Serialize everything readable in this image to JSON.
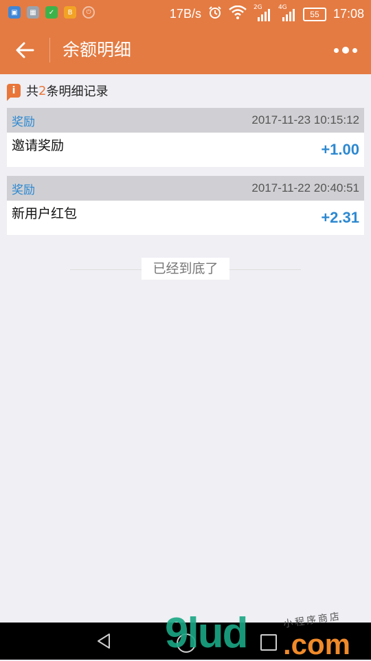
{
  "status_bar": {
    "left_icons": [
      "wallet-icon",
      "image-icon",
      "shield-icon",
      "bitcoin-icon",
      "power-icon"
    ],
    "net_speed": "17B/s",
    "signal_1_label": "2G",
    "signal_2_label": "4G",
    "battery": "55",
    "time": "17:08",
    "colors": {
      "bar": "#e47b42"
    }
  },
  "navbar": {
    "title": "余额明细",
    "back_icon": "arrow-left-icon",
    "more_icon": "more-dots-icon"
  },
  "summary": {
    "prefix": "共",
    "count": "2",
    "suffix": "条明细记录"
  },
  "records": [
    {
      "type": "奖励",
      "time": "2017-11-23 10:15:12",
      "name": "邀请奖励",
      "amount": "+1.00"
    },
    {
      "type": "奖励",
      "time": "2017-11-22 20:40:51",
      "name": "新用户红包",
      "amount": "+2.31"
    }
  ],
  "end_text": "已经到底了",
  "bottom_nav": {
    "back": "triangle-back-icon",
    "home": "circle-home-icon",
    "recent": "square-recent-icon"
  },
  "watermark": {
    "left": "9lud",
    "right": ".com",
    "small": "小程序商店"
  },
  "colors": {
    "accent": "#e47b42",
    "link": "#2d88d0",
    "background": "#efeff4"
  }
}
